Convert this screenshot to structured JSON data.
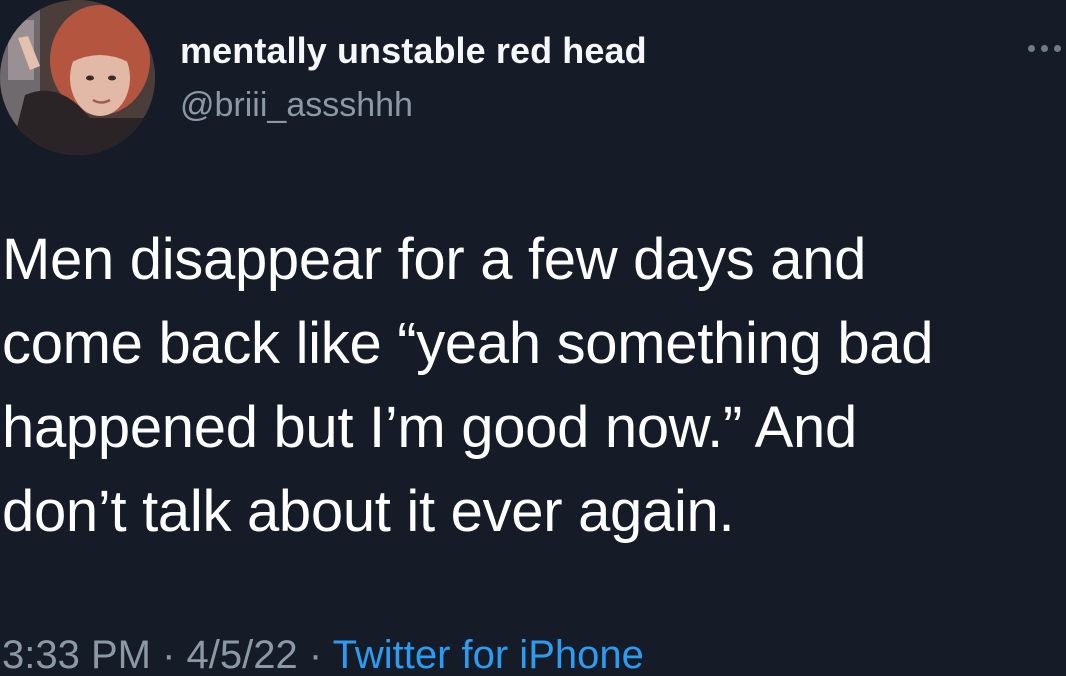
{
  "tweet": {
    "display_name": "mentally unstable red head",
    "handle": "@briii_assshhh",
    "more_icon": "more-horizontal-icon",
    "body_lines": [
      "Men disappear for a few days and",
      "come back like “yeah something bad",
      "happened but I’m good now.” And",
      "don’t talk about it ever again."
    ],
    "time": "3:33 PM",
    "separator": "·",
    "date": "4/5/22",
    "source": "Twitter for iPhone"
  },
  "colors": {
    "background": "#151c28",
    "text": "#ffffff",
    "muted": "#8b98a5",
    "link": "#2d9bf0"
  }
}
